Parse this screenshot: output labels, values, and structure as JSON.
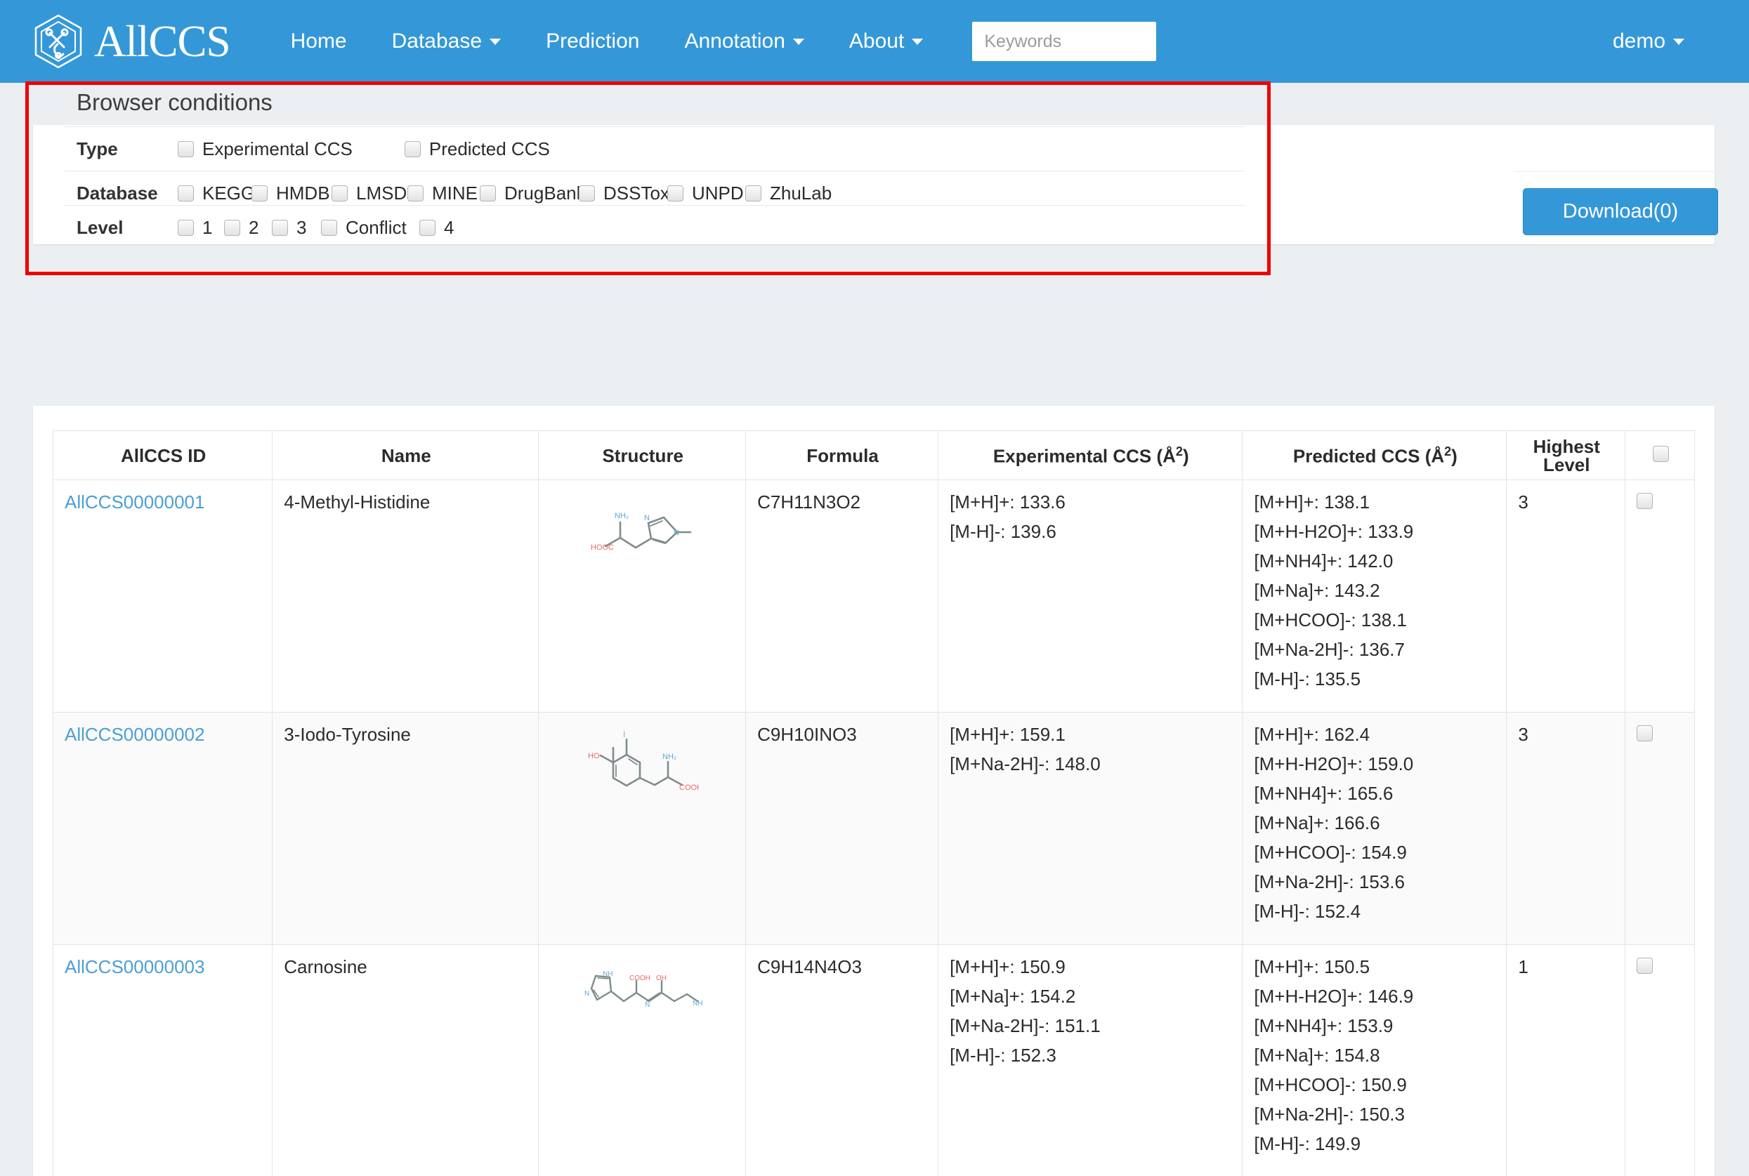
{
  "brand": {
    "name": "AllCCS",
    "logo_icon": "hexagon-molecule-icon"
  },
  "nav": {
    "items": [
      {
        "label": "Home",
        "has_caret": false
      },
      {
        "label": "Database",
        "has_caret": true
      },
      {
        "label": "Prediction",
        "has_caret": false
      },
      {
        "label": "Annotation",
        "has_caret": true
      },
      {
        "label": "About",
        "has_caret": true
      }
    ],
    "search": {
      "placeholder": "Keywords",
      "value": ""
    },
    "user": {
      "label": "demo",
      "has_caret": true
    }
  },
  "conditions": {
    "title": "Browser conditions",
    "rows": [
      {
        "label": "Type",
        "options": [
          "Experimental CCS",
          "Predicted CCS"
        ]
      },
      {
        "label": "Database",
        "options": [
          "KEGG",
          "HMDB",
          "LMSD",
          "MINE",
          "DrugBank",
          "DSSTox",
          "UNPD",
          "ZhuLab"
        ]
      },
      {
        "label": "Level",
        "options": [
          "1",
          "2",
          "3",
          "Conflict",
          "4"
        ]
      }
    ],
    "download_label": "Download(0)"
  },
  "table": {
    "headers": [
      "AllCCS ID",
      "Name",
      "Structure",
      "Formula",
      "Experimental CCS (Å²)",
      "Predicted CCS (Å²)",
      "Highest Level",
      ""
    ],
    "select_all_checkbox": true,
    "rows": [
      {
        "id": "AllCCS00000001",
        "name": "4-Methyl-Histidine",
        "structure_icon": "methyl-histidine-structure",
        "formula": "C7H11N3O2",
        "experimental": [
          "[M+H]+: 133.6",
          "[M-H]-: 139.6"
        ],
        "predicted": [
          "[M+H]+: 138.1",
          "[M+H-H2O]+: 133.9",
          "[M+NH4]+: 142.0",
          "[M+Na]+: 143.2",
          "[M+HCOO]-: 138.1",
          "[M+Na-2H]-: 136.7",
          "[M-H]-: 135.5"
        ],
        "highest_level": "3"
      },
      {
        "id": "AllCCS00000002",
        "name": "3-Iodo-Tyrosine",
        "structure_icon": "iodo-tyrosine-structure",
        "formula": "C9H10INO3",
        "experimental": [
          "[M+H]+: 159.1",
          "[M+Na-2H]-: 148.0"
        ],
        "predicted": [
          "[M+H]+: 162.4",
          "[M+H-H2O]+: 159.0",
          "[M+NH4]+: 165.6",
          "[M+Na]+: 166.6",
          "[M+HCOO]-: 154.9",
          "[M+Na-2H]-: 153.6",
          "[M-H]-: 152.4"
        ],
        "highest_level": "3"
      },
      {
        "id": "AllCCS00000003",
        "name": "Carnosine",
        "structure_icon": "carnosine-structure",
        "formula": "C9H14N4O3",
        "experimental": [
          "[M+H]+: 150.9",
          "[M+Na]+: 154.2",
          "[M+Na-2H]-: 151.1",
          "[M-H]-: 152.3"
        ],
        "predicted": [
          "[M+H]+: 150.5",
          "[M+H-H2O]+: 146.9",
          "[M+NH4]+: 153.9",
          "[M+Na]+: 154.8",
          "[M+HCOO]-: 150.9",
          "[M+Na-2H]-: 150.3",
          "[M-H]-: 149.9"
        ],
        "highest_level": "1"
      }
    ]
  },
  "colors": {
    "brand_blue": "#3498d8",
    "page_bg": "#eceff1",
    "link_blue": "#4a9fd4",
    "highlight_red": "#ee0000"
  }
}
